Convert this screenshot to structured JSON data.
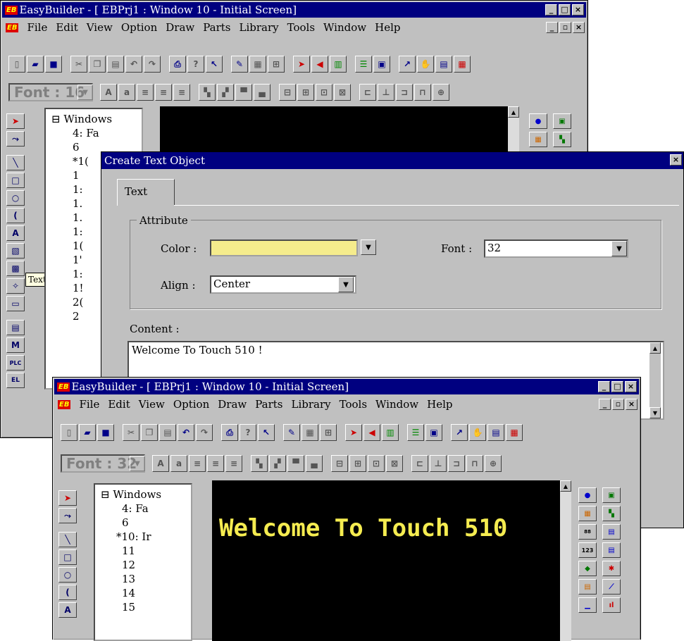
{
  "back_window": {
    "title": "EasyBuilder - [  EBPrj1  :  Window  10  -  Initial Screen]",
    "menus": [
      "File",
      "Edit",
      "View",
      "Option",
      "Draw",
      "Parts",
      "Library",
      "Tools",
      "Window",
      "Help"
    ],
    "font_box": "Font : 16",
    "tree": [
      "Windows",
      "4: Fa",
      "6",
      "*1(",
      "1",
      "1:",
      "1.",
      "1.",
      "1:",
      "1(",
      "1'",
      "1:",
      "1!",
      "2(",
      "2"
    ],
    "tooltip": "Text"
  },
  "dialog": {
    "title": "Create Text Object",
    "tab": "Text",
    "group_label": "Attribute",
    "color_label": "Color :",
    "color_value_hex": "#f5ec8c",
    "font_label": "Font :",
    "font_value": "32",
    "align_label": "Align :",
    "align_value": "Center",
    "content_label": "Content :",
    "content_value": "Welcome To Touch 510 !"
  },
  "front_window": {
    "title": "EasyBuilder - [  EBPrj1  :  Window  10  -  Initial Screen]",
    "menus": [
      "File",
      "Edit",
      "View",
      "Option",
      "Draw",
      "Parts",
      "Library",
      "Tools",
      "Window",
      "Help"
    ],
    "font_box": "Font : 32",
    "tree": [
      "Windows",
      "4: Fa",
      "6",
      "*10: Ir",
      "11",
      "12",
      "13",
      "14",
      "15"
    ],
    "screen_text": "Welcome To Touch 510",
    "screen_text_color": "#f5ec50"
  }
}
